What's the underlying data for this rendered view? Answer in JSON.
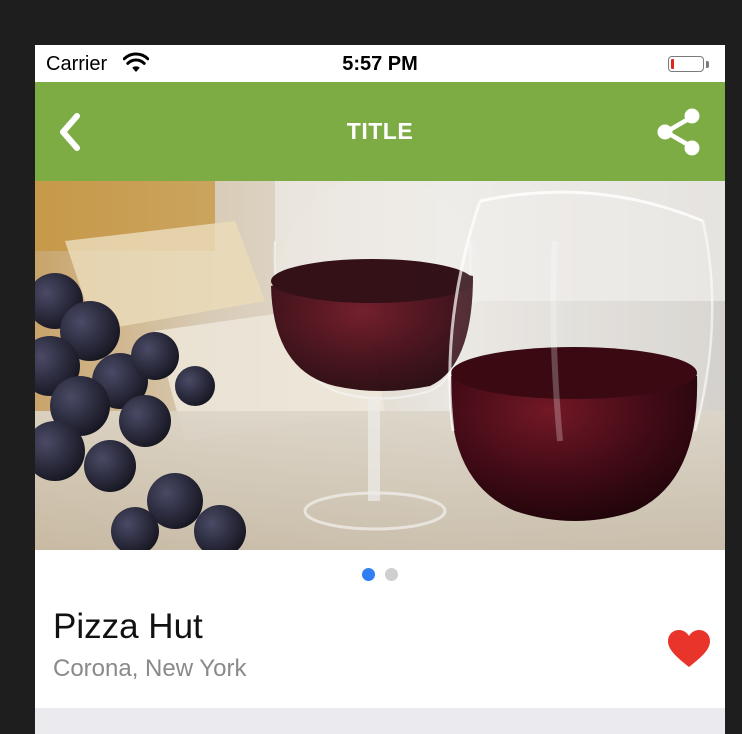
{
  "status_bar": {
    "carrier": "Carrier",
    "time": "5:57 PM",
    "wifi_icon": "wifi-icon",
    "battery_icon": "battery-icon",
    "battery_level": 0.05,
    "battery_color": "#e0251c"
  },
  "nav_bar": {
    "title": "TITLE",
    "back_icon": "chevron-left-icon",
    "share_icon": "share-icon",
    "background_color": "#7cac43"
  },
  "gallery": {
    "image_subject": "wine-glasses-photo",
    "page_count": 2,
    "current_page": 1,
    "active_dot_color": "#2f7ff3",
    "inactive_dot_color": "#cfcfcf"
  },
  "listing": {
    "name": "Pizza Hut",
    "location": "Corona, New York",
    "favorite_icon": "heart-icon",
    "favorite_color": "#e8342a",
    "is_favorite": true
  }
}
